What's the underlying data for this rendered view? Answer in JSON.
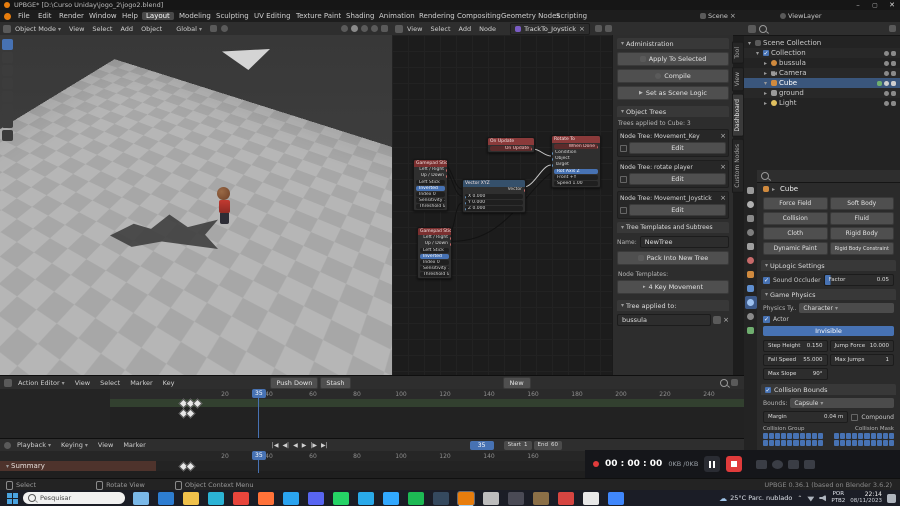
{
  "colors": {
    "accent": "#4772b3",
    "selection": "#3a567c",
    "node_red": "#7a2f2f",
    "floor_light": "#b6b6b6",
    "floor_dark": "#a7a7a7"
  },
  "window": {
    "title": "UPBGE* [D:\\Curso Uniday\\jogo_2\\jogo2.blend]",
    "minimize": "–",
    "maximize": "▢",
    "close": "✕"
  },
  "topbar": {
    "menus": [
      "File",
      "Edit",
      "Render",
      "Window",
      "Help"
    ],
    "workspaces": [
      "Layout",
      "Modeling",
      "Sculpting",
      "UV Editing",
      "Texture Paint",
      "Shading",
      "Animation",
      "Rendering",
      "Compositing",
      "Geometry Nodes",
      "Scripting"
    ],
    "scene": "Scene",
    "view_layer": "ViewLayer"
  },
  "viewport": {
    "mode": "Object Mode",
    "menus": [
      "View",
      "Select",
      "Add",
      "Object"
    ],
    "orientation": "Global"
  },
  "node_editor": {
    "menus": [
      "View",
      "Select",
      "Add",
      "Node"
    ],
    "tree_name": "TrackTo_Joystick",
    "sidebar_tabs": [
      "Tool",
      "View",
      "Dashboard",
      "Custom Nodes"
    ],
    "nodes": [
      {
        "title": "Gamepad Sticks",
        "rows": [
          "Left / Right",
          "Up / Down",
          "Left Stick",
          "Inverted",
          "Index 0",
          "Sensitivity 1.000",
          "Threshold 0.100"
        ]
      },
      {
        "title": "Gamepad Sticks",
        "rows": [
          "Left / Right",
          "Up / Down",
          "Left Stick",
          "Inverted",
          "Index 0",
          "Sensitivity 1.000",
          "Threshold 0.100"
        ]
      },
      {
        "title": "Vector XYZ",
        "rows": [
          "Vector",
          "X 0.000",
          "Y 0.000",
          "Z 0.000"
        ]
      },
      {
        "title": "On Update",
        "rows": [
          "On Update"
        ]
      },
      {
        "title": "Rotate To",
        "rows": [
          "When Done",
          "Condition",
          "Object",
          "Target",
          "Rot Axis  Z",
          "Front  +Y",
          "Speed  1.00"
        ]
      }
    ]
  },
  "logic_panel": {
    "administration": {
      "title": "Administration",
      "apply": "Apply To Selected",
      "compile": "Compile",
      "scene_logic": "Set as Scene Logic"
    },
    "object_trees": {
      "title": "Object Trees",
      "applied_label": "Trees applied to Cube: 3",
      "trees": [
        {
          "name": "Node Tree: Movement_Key",
          "edit": "Edit"
        },
        {
          "name": "Node Tree: rotate player",
          "edit": "Edit"
        },
        {
          "name": "Node Tree: Movement_Joystick",
          "edit": "Edit"
        }
      ]
    },
    "templates": {
      "title": "Tree Templates and Subtrees",
      "name_label": "Name:",
      "name_value": "NewTree",
      "pack": "Pack Into New Tree",
      "node_templates_label": "Node Templates:",
      "template_button": "4 Key Movement"
    },
    "applied_to": {
      "title": "Tree applied to:",
      "value": "bussula"
    }
  },
  "outliner": {
    "rows": [
      {
        "label": "Scene Collection"
      },
      {
        "label": "Collection"
      },
      {
        "label": "bussula"
      },
      {
        "label": "Camera"
      },
      {
        "label": "Cube"
      },
      {
        "label": "ground"
      },
      {
        "label": "Light"
      }
    ]
  },
  "properties": {
    "breadcrumb": "Cube",
    "physics_buttons": [
      "Force Field",
      "Soft Body",
      "Collision",
      "Fluid",
      "Cloth",
      "Rigid Body",
      "Dynamic Paint",
      "Rigid Body Constraint"
    ],
    "uplogic": {
      "title": "UpLogic Settings",
      "sound_occluder": "Sound Occluder",
      "factor_label": "Factor",
      "factor_value": "0.05"
    },
    "game_physics": {
      "title": "Game Physics",
      "type_label": "Physics Ty..",
      "type_value": "Character",
      "actor": "Actor",
      "invisible": "Invisible",
      "fields": [
        [
          "Step Height",
          "0.150"
        ],
        [
          "Jump Force",
          "10.000"
        ],
        [
          "Fall Speed",
          "55.000"
        ],
        [
          "Max Jumps",
          "1"
        ],
        [
          "Max Slope",
          "90°"
        ]
      ]
    },
    "collision": {
      "title": "Collision Bounds",
      "bounds_label": "Bounds:",
      "bounds_value": "Capsule",
      "margin_label": "Margin",
      "margin_value": "0.04 m",
      "compound": "Compound",
      "group_label": "Collision Group",
      "mask_label": "Collision Mask",
      "cells_per_grid": 20
    }
  },
  "dope_sheet": {
    "editor_type": "Action Editor",
    "menus": [
      "View",
      "Select",
      "Marker",
      "Key"
    ],
    "new_button": "New",
    "push_down": "Push Down",
    "stash": "Stash",
    "ruler": [
      20,
      40,
      60,
      80,
      100,
      120,
      140,
      160,
      180,
      200,
      220,
      240
    ],
    "current_frame": "35"
  },
  "timeline": {
    "menus": [
      "Playback",
      "Keying",
      "View",
      "Marker"
    ],
    "current_frame": "35",
    "start_label": "Start",
    "start_value": "1",
    "end_label": "End",
    "end_value": "60",
    "ruler": [
      20,
      40,
      60,
      80,
      100,
      120,
      140,
      160
    ],
    "summary": "Summary"
  },
  "recorder": {
    "time": "00 : 00 : 00",
    "size": "0KB /0KB"
  },
  "status_bar": {
    "item1": "Select",
    "item2": "Rotate View",
    "item3": "Object Context Menu",
    "version": "UPBGE 0.36.1 (based on Blender 3.6.2)"
  },
  "taskbar": {
    "search_placeholder": "Pesquisar",
    "weather": "25°C Parc. nublado",
    "lang_line1": "POR",
    "lang_line2": "PTB2",
    "time": "22:14",
    "date": "08/11/2023",
    "apps": [
      {
        "name": "task-view",
        "color": "#7ab8e8"
      },
      {
        "name": "copilot",
        "color": "#2d7dd2"
      },
      {
        "name": "explorer",
        "color": "#f0c14b"
      },
      {
        "name": "edge",
        "color": "#2bb3d6"
      },
      {
        "name": "chrome",
        "color": "#e8453c"
      },
      {
        "name": "firefox",
        "color": "#ff7139"
      },
      {
        "name": "vscode",
        "color": "#2aa3f0"
      },
      {
        "name": "discord",
        "color": "#5865f2"
      },
      {
        "name": "whatsapp",
        "color": "#25d366"
      },
      {
        "name": "telegram",
        "color": "#29a9ea"
      },
      {
        "name": "photoshop",
        "color": "#31a8ff"
      },
      {
        "name": "spotify",
        "color": "#1db954"
      },
      {
        "name": "steam",
        "color": "#35495e"
      },
      {
        "name": "blender",
        "color": "#e87d0d",
        "active": true
      },
      {
        "name": "unity",
        "color": "#bdbdbd"
      },
      {
        "name": "obs",
        "color": "#4a4a55"
      },
      {
        "name": "gimp",
        "color": "#8b6f47"
      },
      {
        "name": "opera",
        "color": "#d64541"
      },
      {
        "name": "notion",
        "color": "#e8e8e8"
      },
      {
        "name": "zoom",
        "color": "#4087fc"
      }
    ]
  }
}
